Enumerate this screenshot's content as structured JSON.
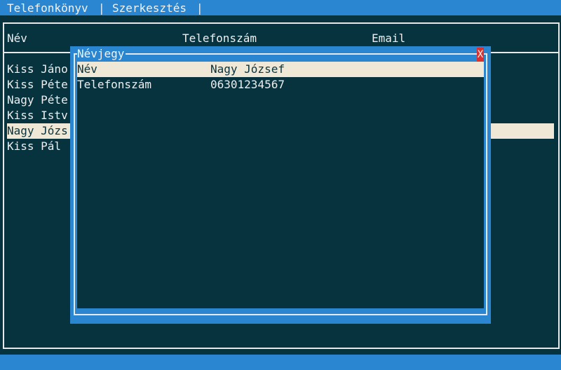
{
  "menubar": {
    "items": [
      "Telefonkönyv",
      "|",
      "Szerkesztés",
      "|"
    ]
  },
  "table": {
    "headers": [
      "Név",
      "Telefonszám",
      "Email"
    ],
    "rows": [
      "Kiss Jáno",
      "Kiss Péte",
      "Nagy Péte",
      "Kiss Istv",
      "Nagy Józs",
      "Kiss Pál"
    ],
    "selected_index": 4
  },
  "dialog": {
    "title": "Névjegy",
    "close_label": "X",
    "fields": [
      {
        "key": "Név",
        "value": "Nagy József"
      },
      {
        "key": "Telefonszám",
        "value": "06301234567"
      }
    ]
  },
  "colors": {
    "background": "#07333f",
    "bar": "#2a86d0",
    "selection": "#efe8d6",
    "close": "#d9312f"
  }
}
